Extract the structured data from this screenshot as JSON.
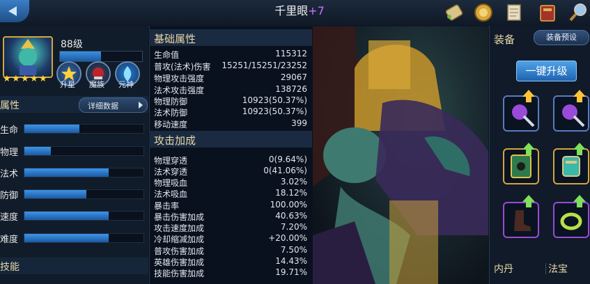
{
  "header": {
    "hero_name": "千里眼",
    "hero_plus": "+7"
  },
  "hero": {
    "level_label": "88级",
    "exp_fraction": 0.5,
    "stars": 5,
    "icons": [
      {
        "label": "升星",
        "icon": "star-up-icon"
      },
      {
        "label": "魔族",
        "icon": "demon-race-icon"
      },
      {
        "label": "元神",
        "icon": "spirit-icon"
      }
    ]
  },
  "attributes": {
    "title": "属性",
    "detail_button": "详细数据",
    "bars": [
      {
        "label": "生命",
        "fraction": 0.46
      },
      {
        "label": "物理",
        "fraction": 0.22
      },
      {
        "label": "法术",
        "fraction": 0.71
      },
      {
        "label": "防御",
        "fraction": 0.52
      },
      {
        "label": "速度",
        "fraction": 0.71
      },
      {
        "label": "难度",
        "fraction": 0.71
      }
    ]
  },
  "skills": {
    "title": "技能"
  },
  "base_stats": {
    "title": "基础属性",
    "rows": [
      {
        "label": "生命值",
        "value": "115312"
      },
      {
        "label": "普攻(法术)伤害",
        "value": "15251/15251/23252"
      },
      {
        "label": "物理攻击强度",
        "value": "29067"
      },
      {
        "label": "法术攻击强度",
        "value": "138726"
      },
      {
        "label": "物理防御",
        "value": "10923(50.37%)"
      },
      {
        "label": "法术防御",
        "value": "10923(50.37%)"
      },
      {
        "label": "移动速度",
        "value": "399"
      }
    ]
  },
  "attack_bonus": {
    "title": "攻击加成",
    "rows": [
      {
        "label": "物理穿透",
        "value": "0(9.64%)"
      },
      {
        "label": "法术穿透",
        "value": "0(41.06%)"
      },
      {
        "label": "物理吸血",
        "value": "3.02%"
      },
      {
        "label": "法术吸血",
        "value": "18.12%"
      },
      {
        "label": "暴击率",
        "value": "100.00%"
      },
      {
        "label": "暴击伤害加成",
        "value": "40.63%"
      },
      {
        "label": "攻击速度加成",
        "value": "7.20%"
      },
      {
        "label": "冷却缩减加成",
        "value": "+20.00%"
      },
      {
        "label": "普攻伤害加成",
        "value": "7.50%"
      },
      {
        "label": "英雄伤害加成",
        "value": "14.43%"
      },
      {
        "label": "技能伤害加成",
        "value": "19.71%"
      }
    ]
  },
  "equipment": {
    "title": "装备",
    "preset_button": "装备预设",
    "upgrade_button": "一键升级",
    "slots": [
      {
        "icon": "staff-icon",
        "upgrade_arrow": "gold"
      },
      {
        "icon": "staff-icon",
        "upgrade_arrow": "gold"
      },
      {
        "icon": "tome-icon",
        "upgrade_arrow": "green"
      },
      {
        "icon": "scroll-armor-icon",
        "upgrade_arrow": "green"
      },
      {
        "icon": "boots-icon",
        "upgrade_arrow": "green"
      },
      {
        "icon": "ring-icon",
        "upgrade_arrow": "green"
      }
    ],
    "neidan_title": "内丹",
    "fabao_title": "法宝"
  },
  "top_icons": [
    "scroll-icon",
    "medal-icon",
    "document-icon",
    "book-icon",
    "magnifier-icon"
  ],
  "colors": {
    "accent_gold": "#e8d9a8",
    "bar_blue": "#3d95e8",
    "plus_purple": "#d070ff",
    "upgrade_green": "#7fe05a"
  }
}
